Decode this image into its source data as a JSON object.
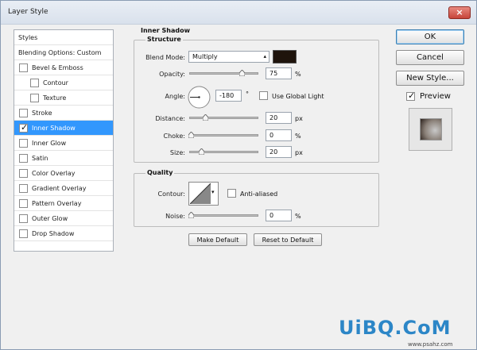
{
  "window": {
    "title": "Layer Style",
    "close_glyph": "×"
  },
  "styles_list": {
    "items": [
      {
        "label": "Styles",
        "has_checkbox": false,
        "checked": false,
        "indent": 0,
        "selected": false
      },
      {
        "label": "Blending Options: Custom",
        "has_checkbox": false,
        "checked": false,
        "indent": 0,
        "selected": false
      },
      {
        "label": "Bevel & Emboss",
        "has_checkbox": true,
        "checked": false,
        "indent": 0,
        "selected": false
      },
      {
        "label": "Contour",
        "has_checkbox": true,
        "checked": false,
        "indent": 1,
        "selected": false
      },
      {
        "label": "Texture",
        "has_checkbox": true,
        "checked": false,
        "indent": 1,
        "selected": false
      },
      {
        "label": "Stroke",
        "has_checkbox": true,
        "checked": false,
        "indent": 0,
        "selected": false
      },
      {
        "label": "Inner Shadow",
        "has_checkbox": true,
        "checked": true,
        "indent": 0,
        "selected": true
      },
      {
        "label": "Inner Glow",
        "has_checkbox": true,
        "checked": false,
        "indent": 0,
        "selected": false
      },
      {
        "label": "Satin",
        "has_checkbox": true,
        "checked": false,
        "indent": 0,
        "selected": false
      },
      {
        "label": "Color Overlay",
        "has_checkbox": true,
        "checked": false,
        "indent": 0,
        "selected": false
      },
      {
        "label": "Gradient Overlay",
        "has_checkbox": true,
        "checked": false,
        "indent": 0,
        "selected": false
      },
      {
        "label": "Pattern Overlay",
        "has_checkbox": true,
        "checked": false,
        "indent": 0,
        "selected": false
      },
      {
        "label": "Outer Glow",
        "has_checkbox": true,
        "checked": false,
        "indent": 0,
        "selected": false
      },
      {
        "label": "Drop Shadow",
        "has_checkbox": true,
        "checked": false,
        "indent": 0,
        "selected": false
      }
    ]
  },
  "inner_shadow": {
    "section_title": "Inner Shadow",
    "structure": {
      "title": "Structure",
      "blend_mode": {
        "label": "Blend Mode:",
        "value": "Multiply",
        "swatch_color": "#1f140c"
      },
      "opacity": {
        "label": "Opacity:",
        "value": "75",
        "unit": "%",
        "level": 0.75
      },
      "angle": {
        "label": "Angle:",
        "value": "-180",
        "unit": "°",
        "use_global_light_label": "Use Global Light",
        "use_global_light": false
      },
      "distance": {
        "label": "Distance:",
        "value": "20",
        "unit": "px",
        "level": 0.08
      },
      "choke": {
        "label": "Choke:",
        "value": "0",
        "unit": "%",
        "level": 0.0
      },
      "size": {
        "label": "Size:",
        "value": "20",
        "unit": "px",
        "level": 0.08
      }
    },
    "quality": {
      "title": "Quality",
      "contour_label": "Contour:",
      "anti_aliased_label": "Anti-aliased",
      "anti_aliased": false,
      "noise": {
        "label": "Noise:",
        "value": "0",
        "unit": "%",
        "level": 0.0
      }
    },
    "make_default_label": "Make Default",
    "reset_default_label": "Reset to Default"
  },
  "actions": {
    "ok_label": "OK",
    "cancel_label": "Cancel",
    "new_style_label": "New Style...",
    "preview_label": "Preview",
    "preview_checked": true
  },
  "watermark": {
    "logo_text": "UiBQ.CoM",
    "url_text": "www.psahz.com"
  },
  "icons": {
    "dropdown": "dropdown-arrow-icon",
    "contour": "contour-curve-icon",
    "angle": "angle-dial-icon",
    "slider": "slider-thumb-icon"
  },
  "colors": {
    "selected_row": "#3297fd",
    "title_bar": "#dfe6ef",
    "close_button": "#c7453a",
    "watermark_blue": "#2c86c7"
  }
}
